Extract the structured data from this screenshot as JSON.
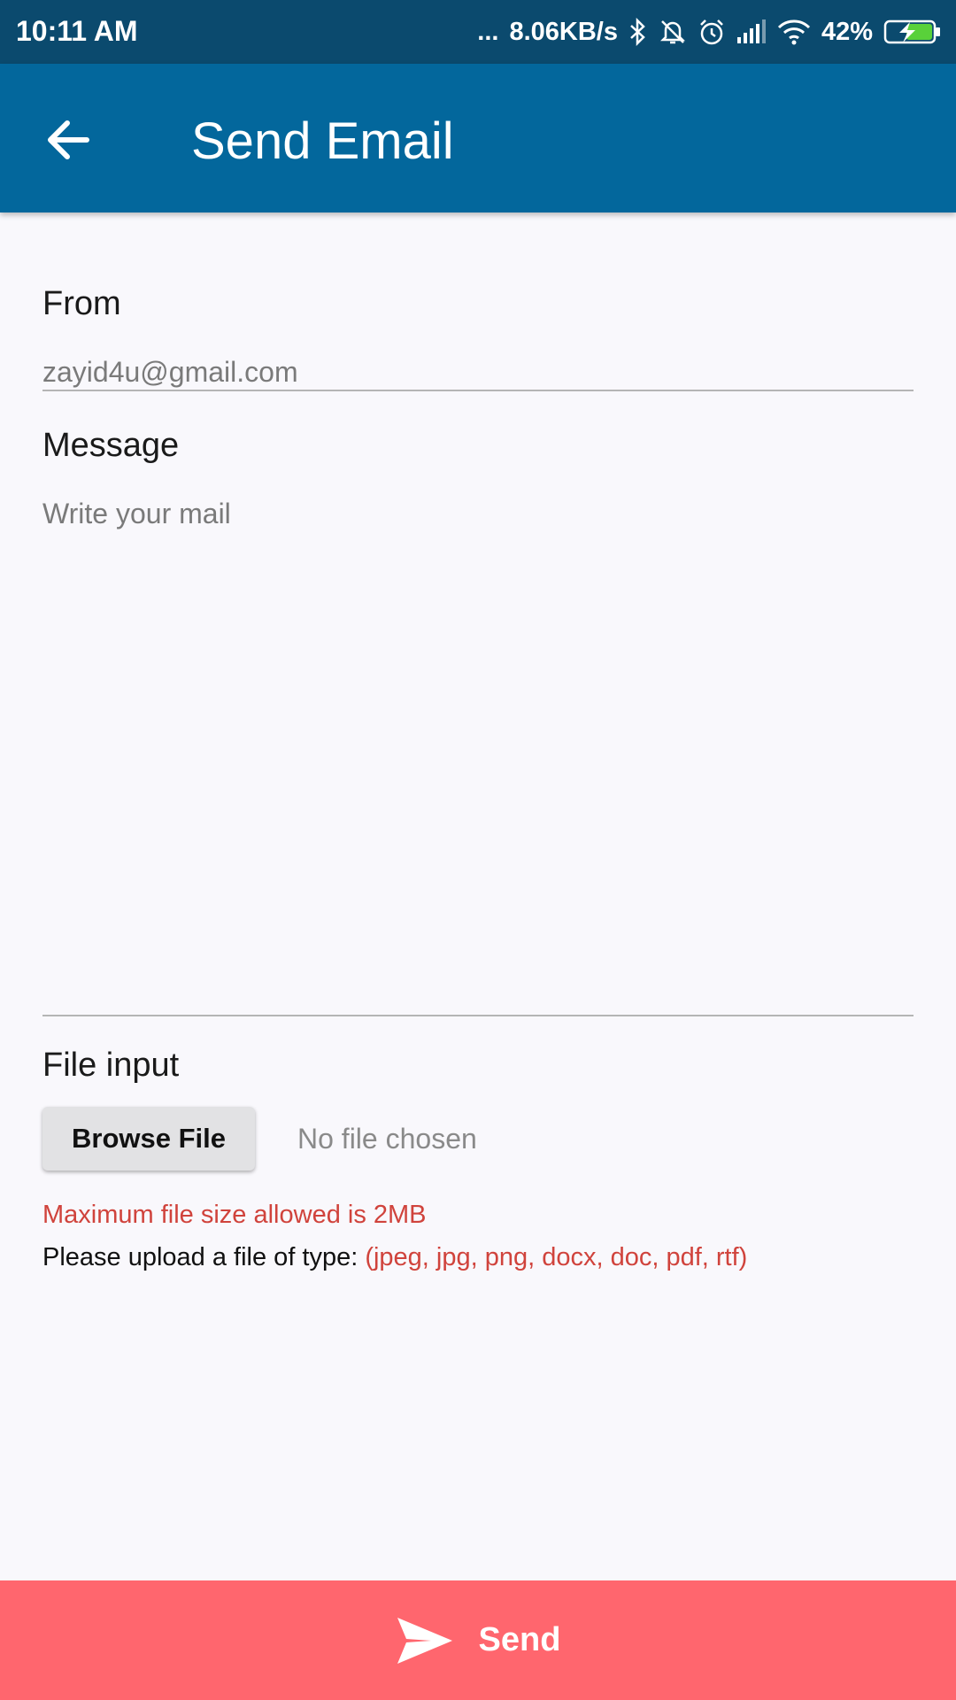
{
  "status_bar": {
    "time": "10:11 AM",
    "dots": "...",
    "net_speed": "8.06KB/s",
    "battery": "42%",
    "icons": [
      "bluetooth-icon",
      "muted-bell-icon",
      "alarm-icon",
      "signal-icon",
      "wifi-icon",
      "battery-charging-icon"
    ]
  },
  "app_bar": {
    "title": "Send Email",
    "back_icon": "arrow-left-icon"
  },
  "form": {
    "from_label": "From",
    "from_value": "zayid4u@gmail.com",
    "message_label": "Message",
    "message_placeholder": "Write your mail",
    "file_label": "File input",
    "browse_label": "Browse File",
    "no_file_text": "No file chosen",
    "size_note": "Maximum file size allowed is 2MB",
    "type_note": "Please upload a file of type:",
    "types": "(jpeg, jpg, png, docx, doc, pdf, rtf)"
  },
  "send": {
    "label": "Send",
    "icon": "send-icon"
  },
  "colors": {
    "status_bar": "#0b4a6e",
    "app_bar": "#03679c",
    "send_bar": "#ff666e",
    "note_red": "#d0433c",
    "background": "#f9f8fc"
  }
}
